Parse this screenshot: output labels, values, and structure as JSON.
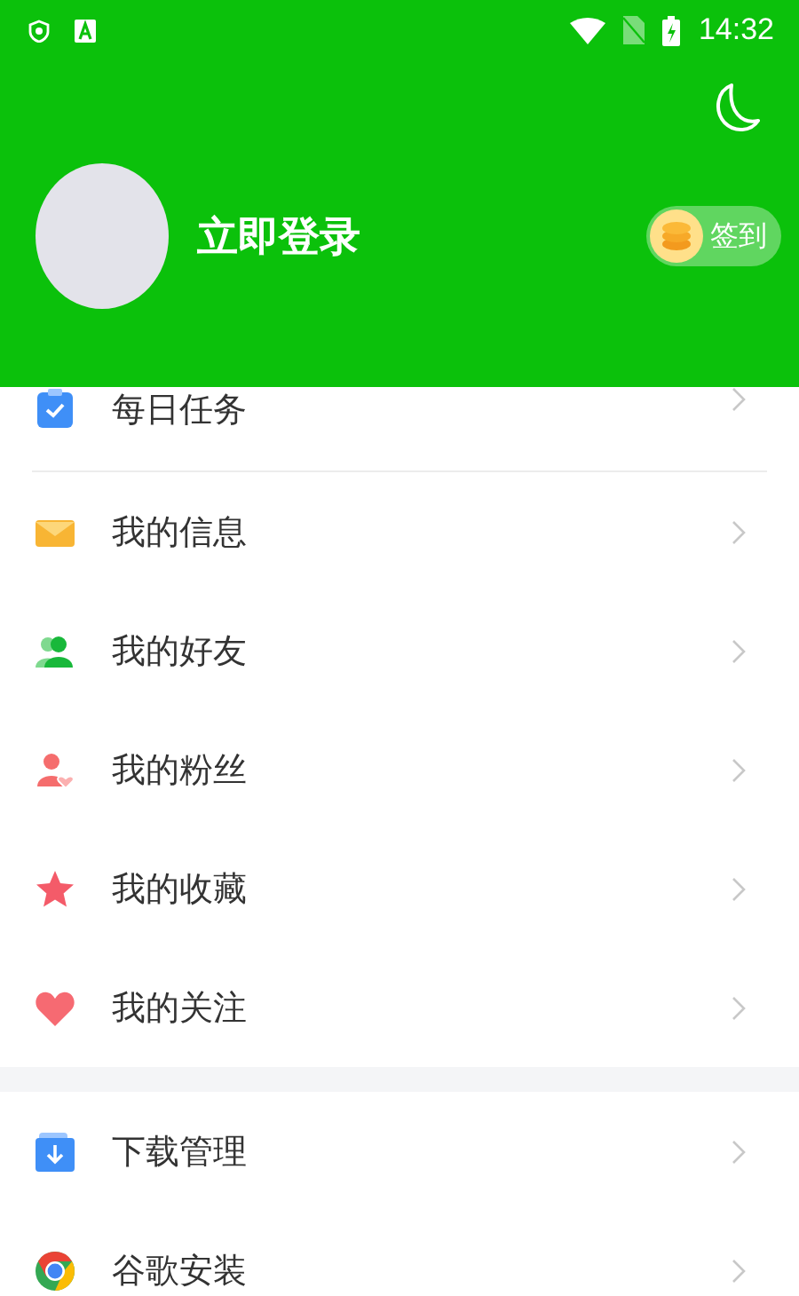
{
  "status_bar": {
    "time": "14:32"
  },
  "profile": {
    "login": "立即登录",
    "checkin": "签到"
  },
  "sections": [
    {
      "kind": "top",
      "items": [
        {
          "label": "每日任务",
          "kind": "task"
        }
      ]
    },
    {
      "kind": "line",
      "items": [
        {
          "label": "我的信息",
          "kind": "mail"
        },
        {
          "label": "我的好友",
          "kind": "friends"
        },
        {
          "label": "我的粉丝",
          "kind": "fans"
        },
        {
          "label": "我的收藏",
          "kind": "star"
        },
        {
          "label": "我的关注",
          "kind": "heart"
        }
      ]
    },
    {
      "kind": "band",
      "items": [
        {
          "label": "下载管理",
          "kind": "download"
        },
        {
          "label": "谷歌安装",
          "kind": "browser"
        }
      ]
    }
  ]
}
